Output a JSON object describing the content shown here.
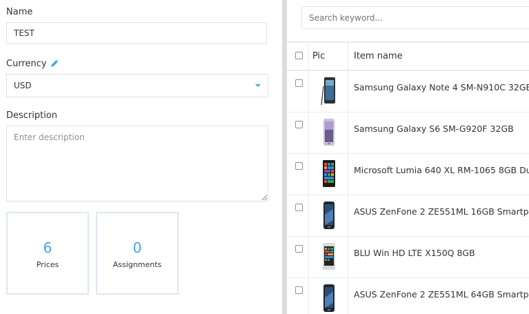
{
  "form": {
    "name_label": "Name",
    "name_value": "TEST",
    "currency_label": "Currency",
    "currency_value": "USD",
    "description_label": "Description",
    "description_placeholder": "Enter description"
  },
  "cards": [
    {
      "count": "6",
      "label": "Prices"
    },
    {
      "count": "0",
      "label": "Assignments"
    }
  ],
  "search": {
    "placeholder": "Search keyword..."
  },
  "table": {
    "columns": {
      "pic": "Pic",
      "item_name": "Item name"
    },
    "rows": [
      {
        "name": "Samsung Galaxy Note 4 SM-N910C 32GB",
        "icon": "note4-phone-icon"
      },
      {
        "name": "Samsung Galaxy S6 SM-G920F 32GB",
        "icon": "galaxy-s6-phone-icon"
      },
      {
        "name": "Microsoft Lumia 640 XL RM-1065 8GB Du",
        "icon": "lumia-phone-icon"
      },
      {
        "name": "ASUS ZenFone 2 ZE551ML 16GB Smartph",
        "icon": "zenfone-phone-icon"
      },
      {
        "name": "BLU Win HD LTE X150Q 8GB",
        "icon": "blu-win-phone-icon"
      },
      {
        "name": "ASUS ZenFone 2 ZE551ML 64GB Smartph",
        "icon": "zenfone-phone-icon"
      }
    ]
  },
  "colors": {
    "accent": "#3aa7e5",
    "border": "#dde3e8",
    "divider": "#dcdcdc"
  }
}
